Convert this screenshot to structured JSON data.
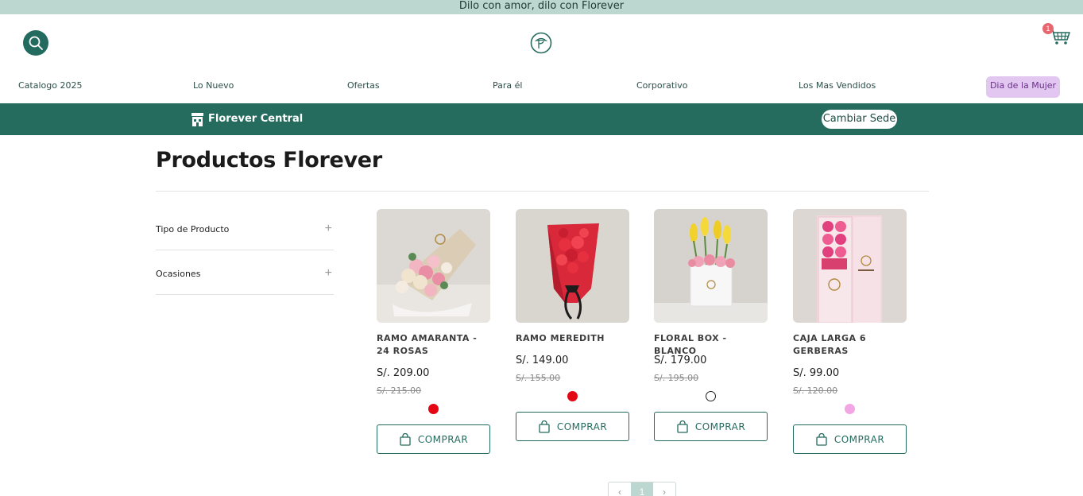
{
  "announcement": "Dilo con amor, dilo con Florever",
  "header": {
    "search_icon": "search-icon",
    "logo_icon": "florever-logo",
    "cart_icon": "cart-icon",
    "cart_count": "1"
  },
  "nav": {
    "items": [
      "Catalogo 2025",
      "Lo Nuevo",
      "Ofertas",
      "Para él",
      "Corporativo",
      "Los Mas Vendidos"
    ],
    "highlight": "Dia de la Mujer"
  },
  "sede": {
    "name": "Florever Central",
    "change_label": "Cambiar Sede"
  },
  "page_title": "Productos Florever",
  "filters": [
    "Tipo de Producto",
    "Ocasiones"
  ],
  "products": [
    {
      "name": "RAMO AMARANTA - 24 ROSAS",
      "price": "S/. 209.00",
      "old_price": "S/. 215.00",
      "swatch": "#e30613",
      "button": "COMPRAR"
    },
    {
      "name": "RAMO MEREDITH",
      "price": "S/. 149.00",
      "old_price": "S/. 155.00",
      "swatch": "#e30613",
      "button": "COMPRAR"
    },
    {
      "name": "FLORAL BOX - BLANCO",
      "price": "S/. 179.00",
      "old_price": "S/. 195.00",
      "swatch": "#ffffff",
      "button": "COMPRAR"
    },
    {
      "name": "CAJA LARGA 6 GERBERAS",
      "price": "S/. 99.00",
      "old_price": "S/. 120.00",
      "swatch": "#f3a6e6",
      "button": "COMPRAR"
    }
  ],
  "pagination": {
    "current": "1"
  },
  "colors": {
    "brand": "#256b5e",
    "announcement_bg": "#bcd7d0",
    "highlight_bg": "#e2c7f1"
  }
}
